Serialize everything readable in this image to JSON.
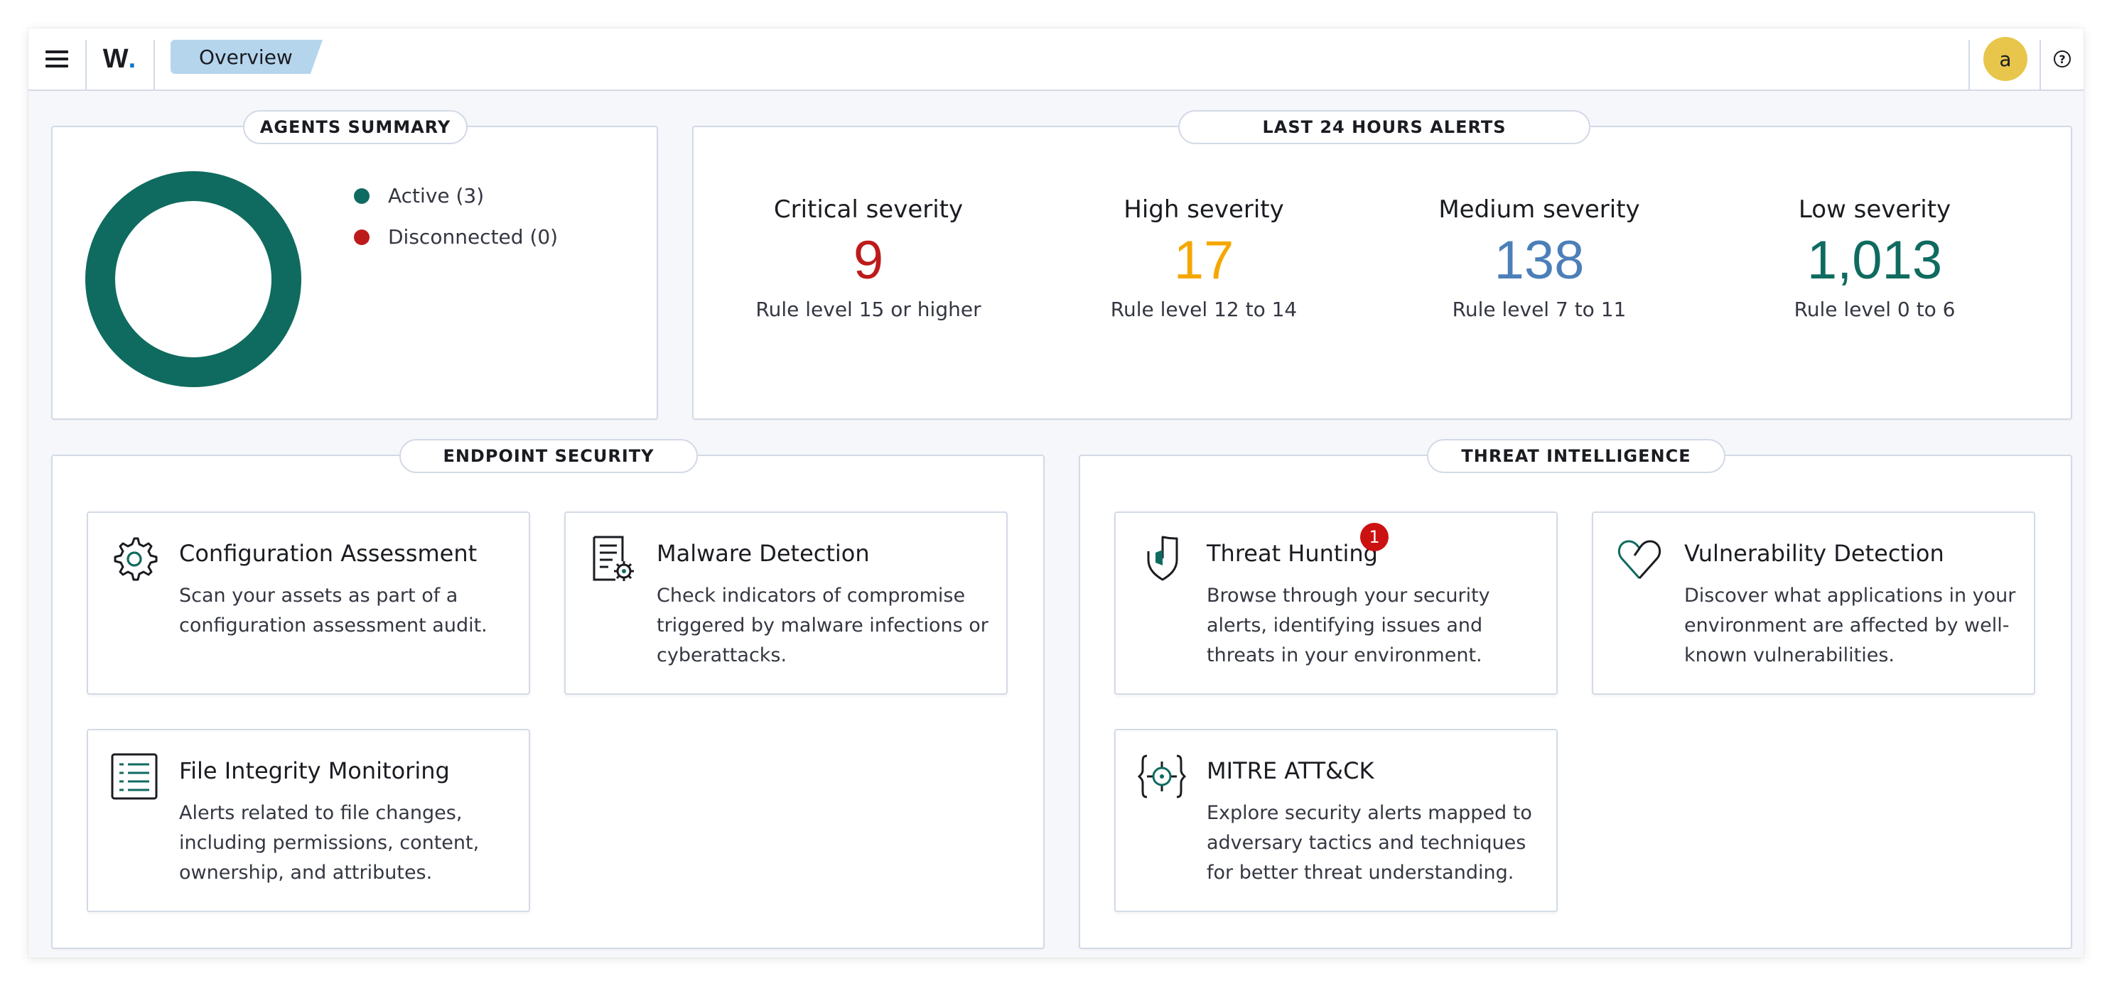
{
  "header": {
    "logo_text": "W",
    "logo_dot": ".",
    "breadcrumb": "Overview",
    "avatar_initial": "a",
    "help_glyph": "?"
  },
  "agents_summary": {
    "title": "AGENTS SUMMARY",
    "legend": [
      {
        "label": "Active (3)",
        "color": "#0f6b5f"
      },
      {
        "label": "Disconnected (0)",
        "color": "#bd1b1b"
      }
    ],
    "donut": {
      "active": 3,
      "disconnected": 0,
      "color": "#0f6b5f"
    }
  },
  "alerts": {
    "title": "LAST 24 HOURS ALERTS",
    "items": [
      {
        "label": "Critical severity",
        "value": "9",
        "sub": "Rule level 15 or higher",
        "color": "#bd1b1b"
      },
      {
        "label": "High severity",
        "value": "17",
        "sub": "Rule level 12 to 14",
        "color": "#f5a700"
      },
      {
        "label": "Medium severity",
        "value": "138",
        "sub": "Rule level 7 to 11",
        "color": "#4c7fb8"
      },
      {
        "label": "Low severity",
        "value": "1,013",
        "sub": "Rule level 0 to 6",
        "color": "#0f6b5f"
      }
    ]
  },
  "endpoint_security": {
    "title": "ENDPOINT SECURITY",
    "cards": [
      {
        "title": "Configuration Assessment",
        "desc": "Scan your assets as part of a configuration assessment audit.",
        "icon": "gear-icon"
      },
      {
        "title": "Malware Detection",
        "desc": "Check indicators of compromise triggered by malware infections or cyberattacks.",
        "icon": "document-gear-icon"
      },
      {
        "title": "File Integrity Monitoring",
        "desc": "Alerts related to file changes, including permissions, content, ownership, and attributes.",
        "icon": "list-icon"
      }
    ]
  },
  "threat_intelligence": {
    "title": "THREAT INTELLIGENCE",
    "cards": [
      {
        "title": "Threat Hunting",
        "desc": "Browse through your security alerts, identifying issues and threats in your environment.",
        "icon": "shield-icon",
        "badge": "1"
      },
      {
        "title": "Vulnerability Detection",
        "desc": "Discover what applications in your environment are affected by well-known vulnerabilities.",
        "icon": "heart-icon"
      },
      {
        "title": "MITRE ATT&CK",
        "desc": "Explore security alerts mapped to adversary tactics and techniques for better threat understanding.",
        "icon": "crosshair-icon"
      }
    ]
  },
  "colors": {
    "accent": "#0f6b5f",
    "breadcrumb_bg": "#b5d5ed",
    "avatar_bg": "#e7c64b",
    "badge": "#cc1111"
  }
}
